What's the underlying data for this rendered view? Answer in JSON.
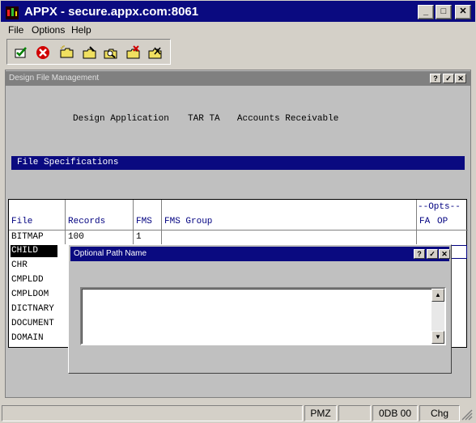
{
  "window": {
    "title": "APPX - secure.appx.com:8061",
    "buttons": {
      "minimize": "_",
      "maximize": "□",
      "close": "✕"
    }
  },
  "menu": {
    "items": [
      "File",
      "Options",
      "Help"
    ]
  },
  "toolbar": {
    "icons": [
      "check-icon",
      "cancel-icon",
      "new-folder-icon",
      "edit-folder-icon",
      "search-folder-icon",
      "delete-folder-icon",
      "cut-folder-icon"
    ]
  },
  "child": {
    "title": "Design File Management",
    "buttons": {
      "help": "?",
      "ok": "✓",
      "close": "✕"
    },
    "design_label": "Design Application",
    "app_code": "TAR TA",
    "app_name": "Accounts Receivable",
    "section_title": "File Specifications"
  },
  "table": {
    "opts_label": "--Opts--",
    "headers": {
      "file": "File",
      "records": "Records",
      "fms": "FMS",
      "fms_group": "FMS Group",
      "fa": "FA",
      "op": "OP"
    },
    "rows": [
      {
        "file": "BITMAP",
        "records": "100",
        "fms": "1"
      },
      {
        "file": "CHILD",
        "records": "",
        "fms": ""
      },
      {
        "file": "CHR",
        "records": "",
        "fms": ""
      },
      {
        "file": "CMPLDD",
        "records": "",
        "fms": ""
      },
      {
        "file": "CMPLDOM",
        "records": "",
        "fms": ""
      },
      {
        "file": "DICTNARY",
        "records": "",
        "fms": ""
      },
      {
        "file": "DOCUMENT",
        "records": "",
        "fms": ""
      },
      {
        "file": "DOMAIN",
        "records": "",
        "fms": ""
      }
    ]
  },
  "dialog": {
    "title": "Optional Path Name",
    "buttons": {
      "help": "?",
      "ok": "✓",
      "close": "✕"
    },
    "value": ""
  },
  "statusbar": {
    "panels": [
      "",
      "PMZ",
      "",
      "0DB 00",
      "Chg"
    ]
  }
}
